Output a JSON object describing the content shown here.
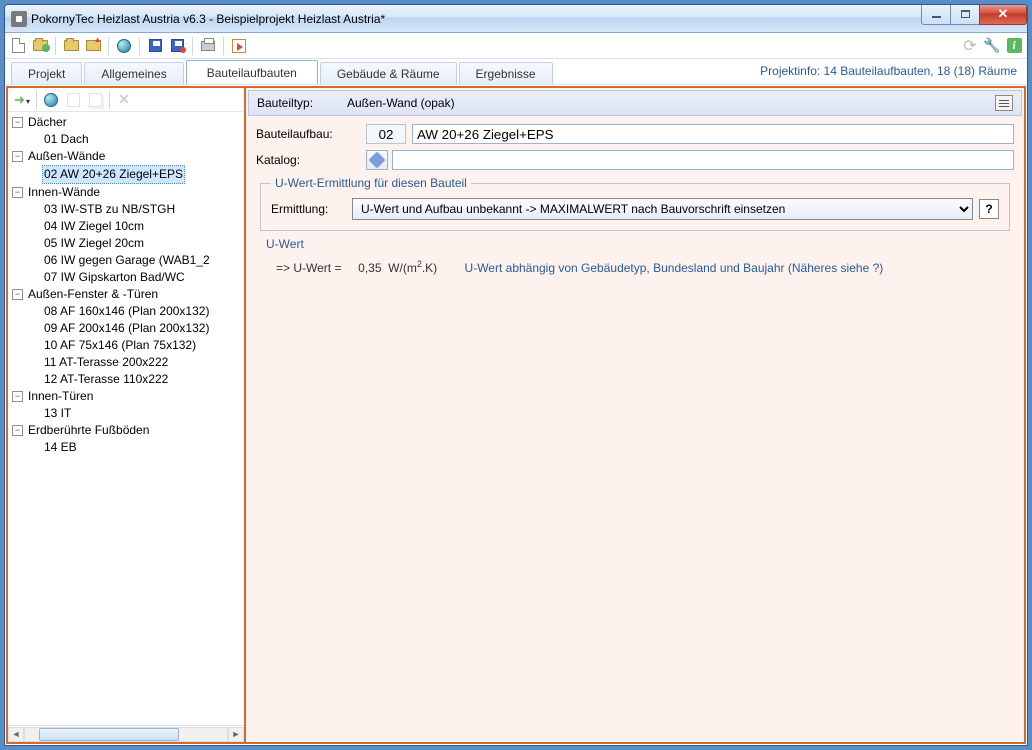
{
  "titlebar": {
    "app": "PokornyTec  Heizlast Austria v6.3",
    "sep": "  -  ",
    "project": "Beispielprojekt Heizlast Austria*"
  },
  "tabs": {
    "projekt": "Projekt",
    "allgemeines": "Allgemeines",
    "bauteilaufbauten": "Bauteilaufbauten",
    "gebaeude": "Gebäude & Räume",
    "ergebnisse": "Ergebnisse"
  },
  "projectinfo": "Projektinfo: 14 Bauteilaufbauten,  18 (18) Räume",
  "tree": {
    "daecher": "Dächer",
    "daecher_items": {
      "i01": "01 Dach"
    },
    "aussenwaende": "Außen-Wände",
    "aussenwaende_items": {
      "i02": "02 AW 20+26 Ziegel+EPS"
    },
    "innenwaende": "Innen-Wände",
    "innenwaende_items": {
      "i03": "03 IW-STB zu NB/STGH",
      "i04": "04 IW Ziegel 10cm",
      "i05": "05 IW Ziegel 20cm",
      "i06": "06 IW gegen Garage (WAB1_2",
      "i07": "07 IW Gipskarton Bad/WC"
    },
    "aussenfenster": "Außen-Fenster & -Türen",
    "aussenfenster_items": {
      "i08": "08 AF 160x146 (Plan 200x132)",
      "i09": "09 AF 200x146 (Plan 200x132)",
      "i10": "10 AF 75x146 (Plan 75x132)",
      "i11": "11 AT-Terasse 200x222",
      "i12": "12 AT-Terasse 110x222"
    },
    "innentueren": "Innen-Türen",
    "innentueren_items": {
      "i13": "13 IT"
    },
    "erdboden": "Erdberührte Fußböden",
    "erdboden_items": {
      "i14": "14 EB"
    }
  },
  "detail": {
    "typ_label": "Bauteiltyp:",
    "typ_value": "Außen-Wand (opak)",
    "aufbau_label": "Bauteilaufbau:",
    "aufbau_num": "02",
    "aufbau_name": "AW 20+26 Ziegel+EPS",
    "katalog_label": "Katalog:",
    "katalog_value": "",
    "ermittlung_legend": "U-Wert-Ermittlung für diesen Bauteil",
    "ermittlung_label": "Ermittlung:",
    "ermittlung_option": "U-Wert und Aufbau unbekannt -> MAXIMALWERT nach Bauvorschrift einsetzen",
    "uwert_title": "U-Wert",
    "uwert_prefix": "=> U-Wert =",
    "uwert_value": "0,35",
    "uwert_unit_pre": "W/(m",
    "uwert_unit_sup": "2",
    "uwert_unit_post": ".K)",
    "uwert_note": "U-Wert abhängig von Gebäudetyp, Bundesland und Baujahr (Näheres siehe ?)",
    "help": "?"
  }
}
